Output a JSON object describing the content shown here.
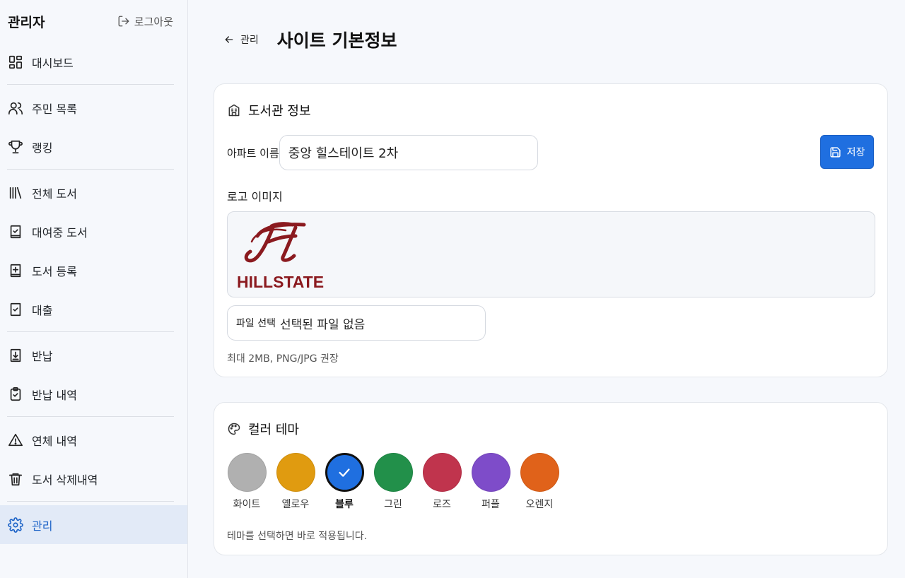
{
  "sidebar": {
    "title": "관리자",
    "logout_label": "로그아웃",
    "items": [
      {
        "label": "대시보드",
        "icon": "dashboard-icon"
      },
      {
        "label": "주민 목록",
        "icon": "users-icon"
      },
      {
        "label": "랭킹",
        "icon": "trophy-icon"
      },
      {
        "label": "전체 도서",
        "icon": "library-icon"
      },
      {
        "label": "대여중 도서",
        "icon": "book-check-icon"
      },
      {
        "label": "도서 등록",
        "icon": "book-plus-icon"
      },
      {
        "label": "대출",
        "icon": "checkbox-icon"
      },
      {
        "label": "반납",
        "icon": "download-box-icon"
      },
      {
        "label": "반납 내역",
        "icon": "clipboard-check-icon"
      },
      {
        "label": "연체 내역",
        "icon": "warning-icon"
      },
      {
        "label": "도서 삭제내역",
        "icon": "trash-icon"
      },
      {
        "label": "관리",
        "icon": "gear-icon",
        "active": true
      }
    ]
  },
  "header": {
    "back_label": "관리",
    "title": "사이트 기본정보"
  },
  "library_card": {
    "title": "도서관 정보",
    "apt_label": "아파트 이름",
    "apt_value": "중앙 힐스테이트 2차",
    "save_label": "저장",
    "logo_label": "로고 이미지",
    "logo_text": "HILLSTATE",
    "file_button": "파일 선택",
    "file_status": "선택된 파일 없음",
    "hint": "최대 2MB, PNG/JPG 권장"
  },
  "theme_card": {
    "title": "컬러 테마",
    "hint": "테마를 선택하면 바로 적용됩니다.",
    "selected": "블루",
    "swatches": [
      {
        "label": "화이트",
        "color": "#b0b0b0"
      },
      {
        "label": "옐로우",
        "color": "#e09b10"
      },
      {
        "label": "블루",
        "color": "#1f6fe0"
      },
      {
        "label": "그린",
        "color": "#22904a"
      },
      {
        "label": "로즈",
        "color": "#c0344d"
      },
      {
        "label": "퍼플",
        "color": "#7e4cc9"
      },
      {
        "label": "오렌지",
        "color": "#e0621a"
      }
    ]
  },
  "colors": {
    "accent": "#1f6fe0",
    "active_bg": "#e2eaf7",
    "logo_red": "#8b1a1f"
  }
}
